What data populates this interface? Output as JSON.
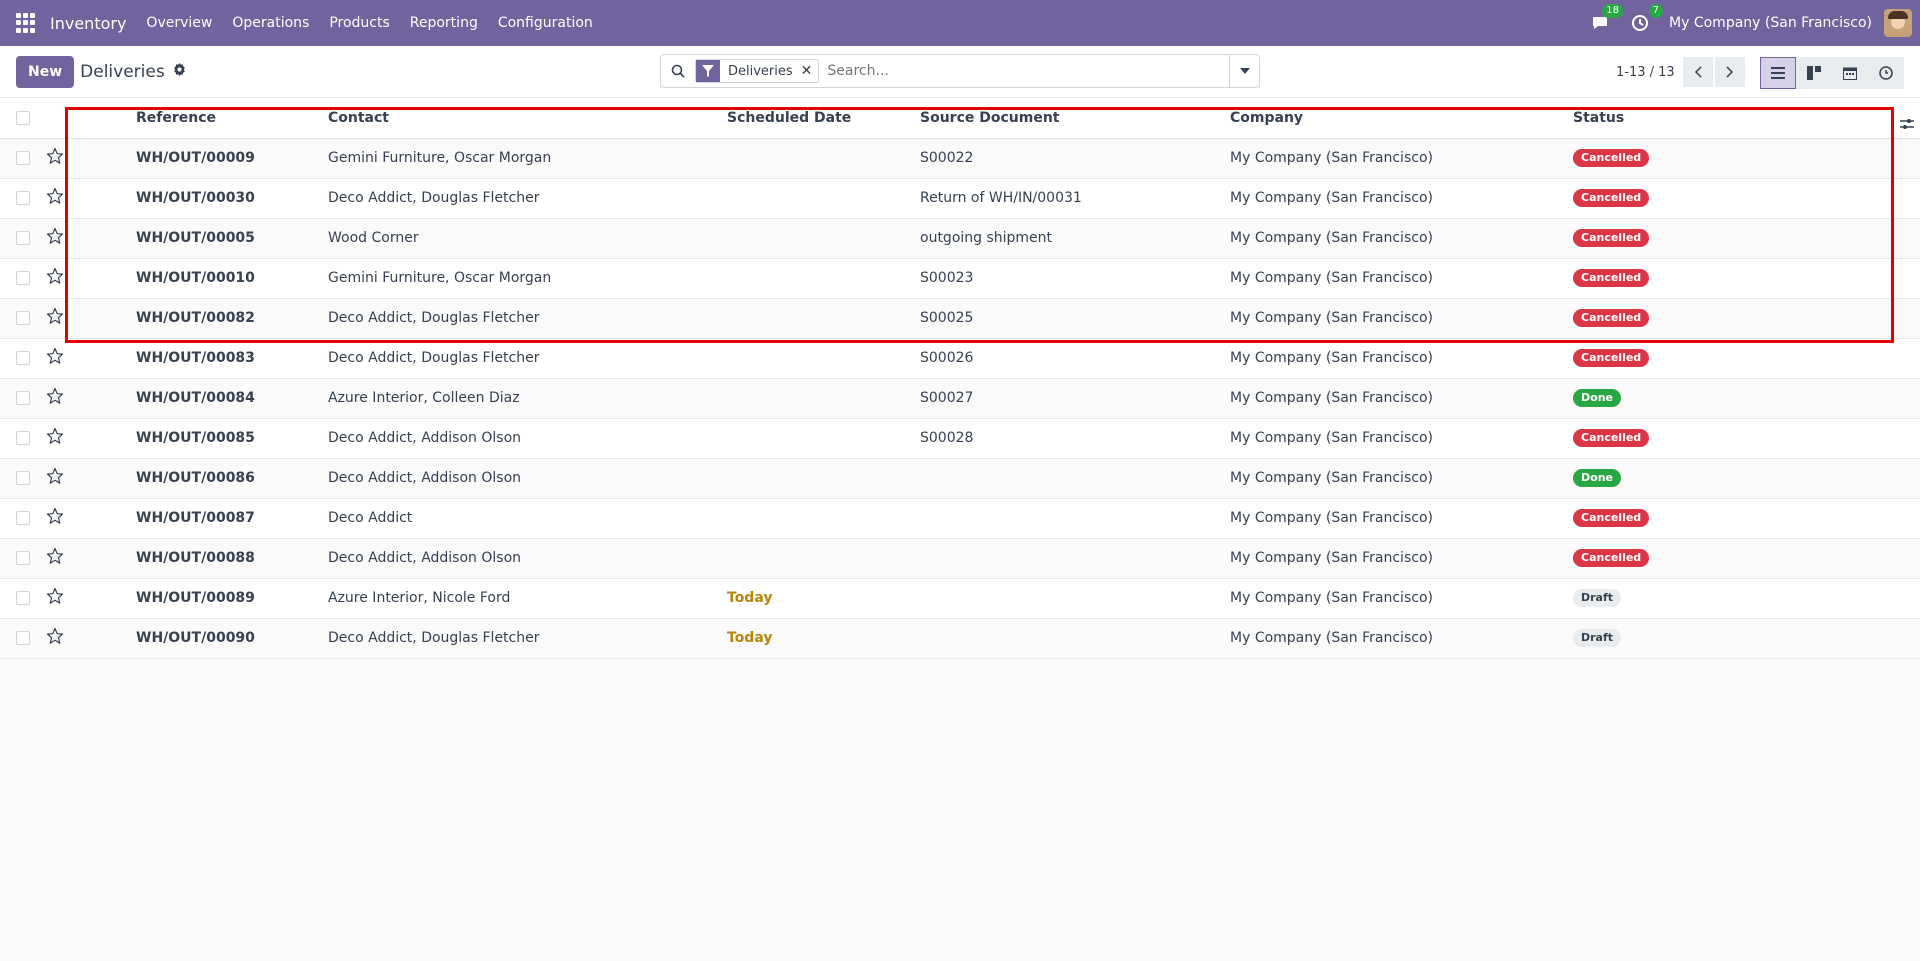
{
  "navbar": {
    "app_name": "Inventory",
    "menu": [
      "Overview",
      "Operations",
      "Products",
      "Reporting",
      "Configuration"
    ],
    "messages_count": "18",
    "activities_count": "7",
    "company": "My Company (San Francisco)",
    "bg_color": "#71639e"
  },
  "control": {
    "new_label": "New",
    "title": "Deliveries",
    "facet_label": "Deliveries",
    "search_placeholder": "Search...",
    "pager": "1-13 / 13"
  },
  "table": {
    "headers": {
      "reference": "Reference",
      "contact": "Contact",
      "scheduled_date": "Scheduled Date",
      "source": "Source Document",
      "company": "Company",
      "status": "Status"
    },
    "rows": [
      {
        "reference": "WH/OUT/00009",
        "contact": "Gemini Furniture, Oscar Morgan",
        "date": "",
        "source": "S00022",
        "company": "My Company (San Francisco)",
        "status": "Cancelled"
      },
      {
        "reference": "WH/OUT/00030",
        "contact": "Deco Addict, Douglas Fletcher",
        "date": "",
        "source": "Return of WH/IN/00031",
        "company": "My Company (San Francisco)",
        "status": "Cancelled"
      },
      {
        "reference": "WH/OUT/00005",
        "contact": "Wood Corner",
        "date": "",
        "source": "outgoing shipment",
        "company": "My Company (San Francisco)",
        "status": "Cancelled"
      },
      {
        "reference": "WH/OUT/00010",
        "contact": "Gemini Furniture, Oscar Morgan",
        "date": "",
        "source": "S00023",
        "company": "My Company (San Francisco)",
        "status": "Cancelled"
      },
      {
        "reference": "WH/OUT/00082",
        "contact": "Deco Addict, Douglas Fletcher",
        "date": "",
        "source": "S00025",
        "company": "My Company (San Francisco)",
        "status": "Cancelled"
      },
      {
        "reference": "WH/OUT/00083",
        "contact": "Deco Addict, Douglas Fletcher",
        "date": "",
        "source": "S00026",
        "company": "My Company (San Francisco)",
        "status": "Cancelled"
      },
      {
        "reference": "WH/OUT/00084",
        "contact": "Azure Interior, Colleen Diaz",
        "date": "",
        "source": "S00027",
        "company": "My Company (San Francisco)",
        "status": "Done"
      },
      {
        "reference": "WH/OUT/00085",
        "contact": "Deco Addict, Addison Olson",
        "date": "",
        "source": "S00028",
        "company": "My Company (San Francisco)",
        "status": "Cancelled"
      },
      {
        "reference": "WH/OUT/00086",
        "contact": "Deco Addict, Addison Olson",
        "date": "",
        "source": "",
        "company": "My Company (San Francisco)",
        "status": "Done"
      },
      {
        "reference": "WH/OUT/00087",
        "contact": "Deco Addict",
        "date": "",
        "source": "",
        "company": "My Company (San Francisco)",
        "status": "Cancelled"
      },
      {
        "reference": "WH/OUT/00088",
        "contact": "Deco Addict, Addison Olson",
        "date": "",
        "source": "",
        "company": "My Company (San Francisco)",
        "status": "Cancelled"
      },
      {
        "reference": "WH/OUT/00089",
        "contact": "Azure Interior, Nicole Ford",
        "date": "Today",
        "source": "",
        "company": "My Company (San Francisco)",
        "status": "Draft"
      },
      {
        "reference": "WH/OUT/00090",
        "contact": "Deco Addict, Douglas Fletcher",
        "date": "Today",
        "source": "",
        "company": "My Company (San Francisco)",
        "status": "Draft"
      }
    ]
  },
  "status_colors": {
    "Cancelled": "#dc3545",
    "Done": "#28a745",
    "Draft": "#e9ecef"
  },
  "highlight_color": "#e50000"
}
